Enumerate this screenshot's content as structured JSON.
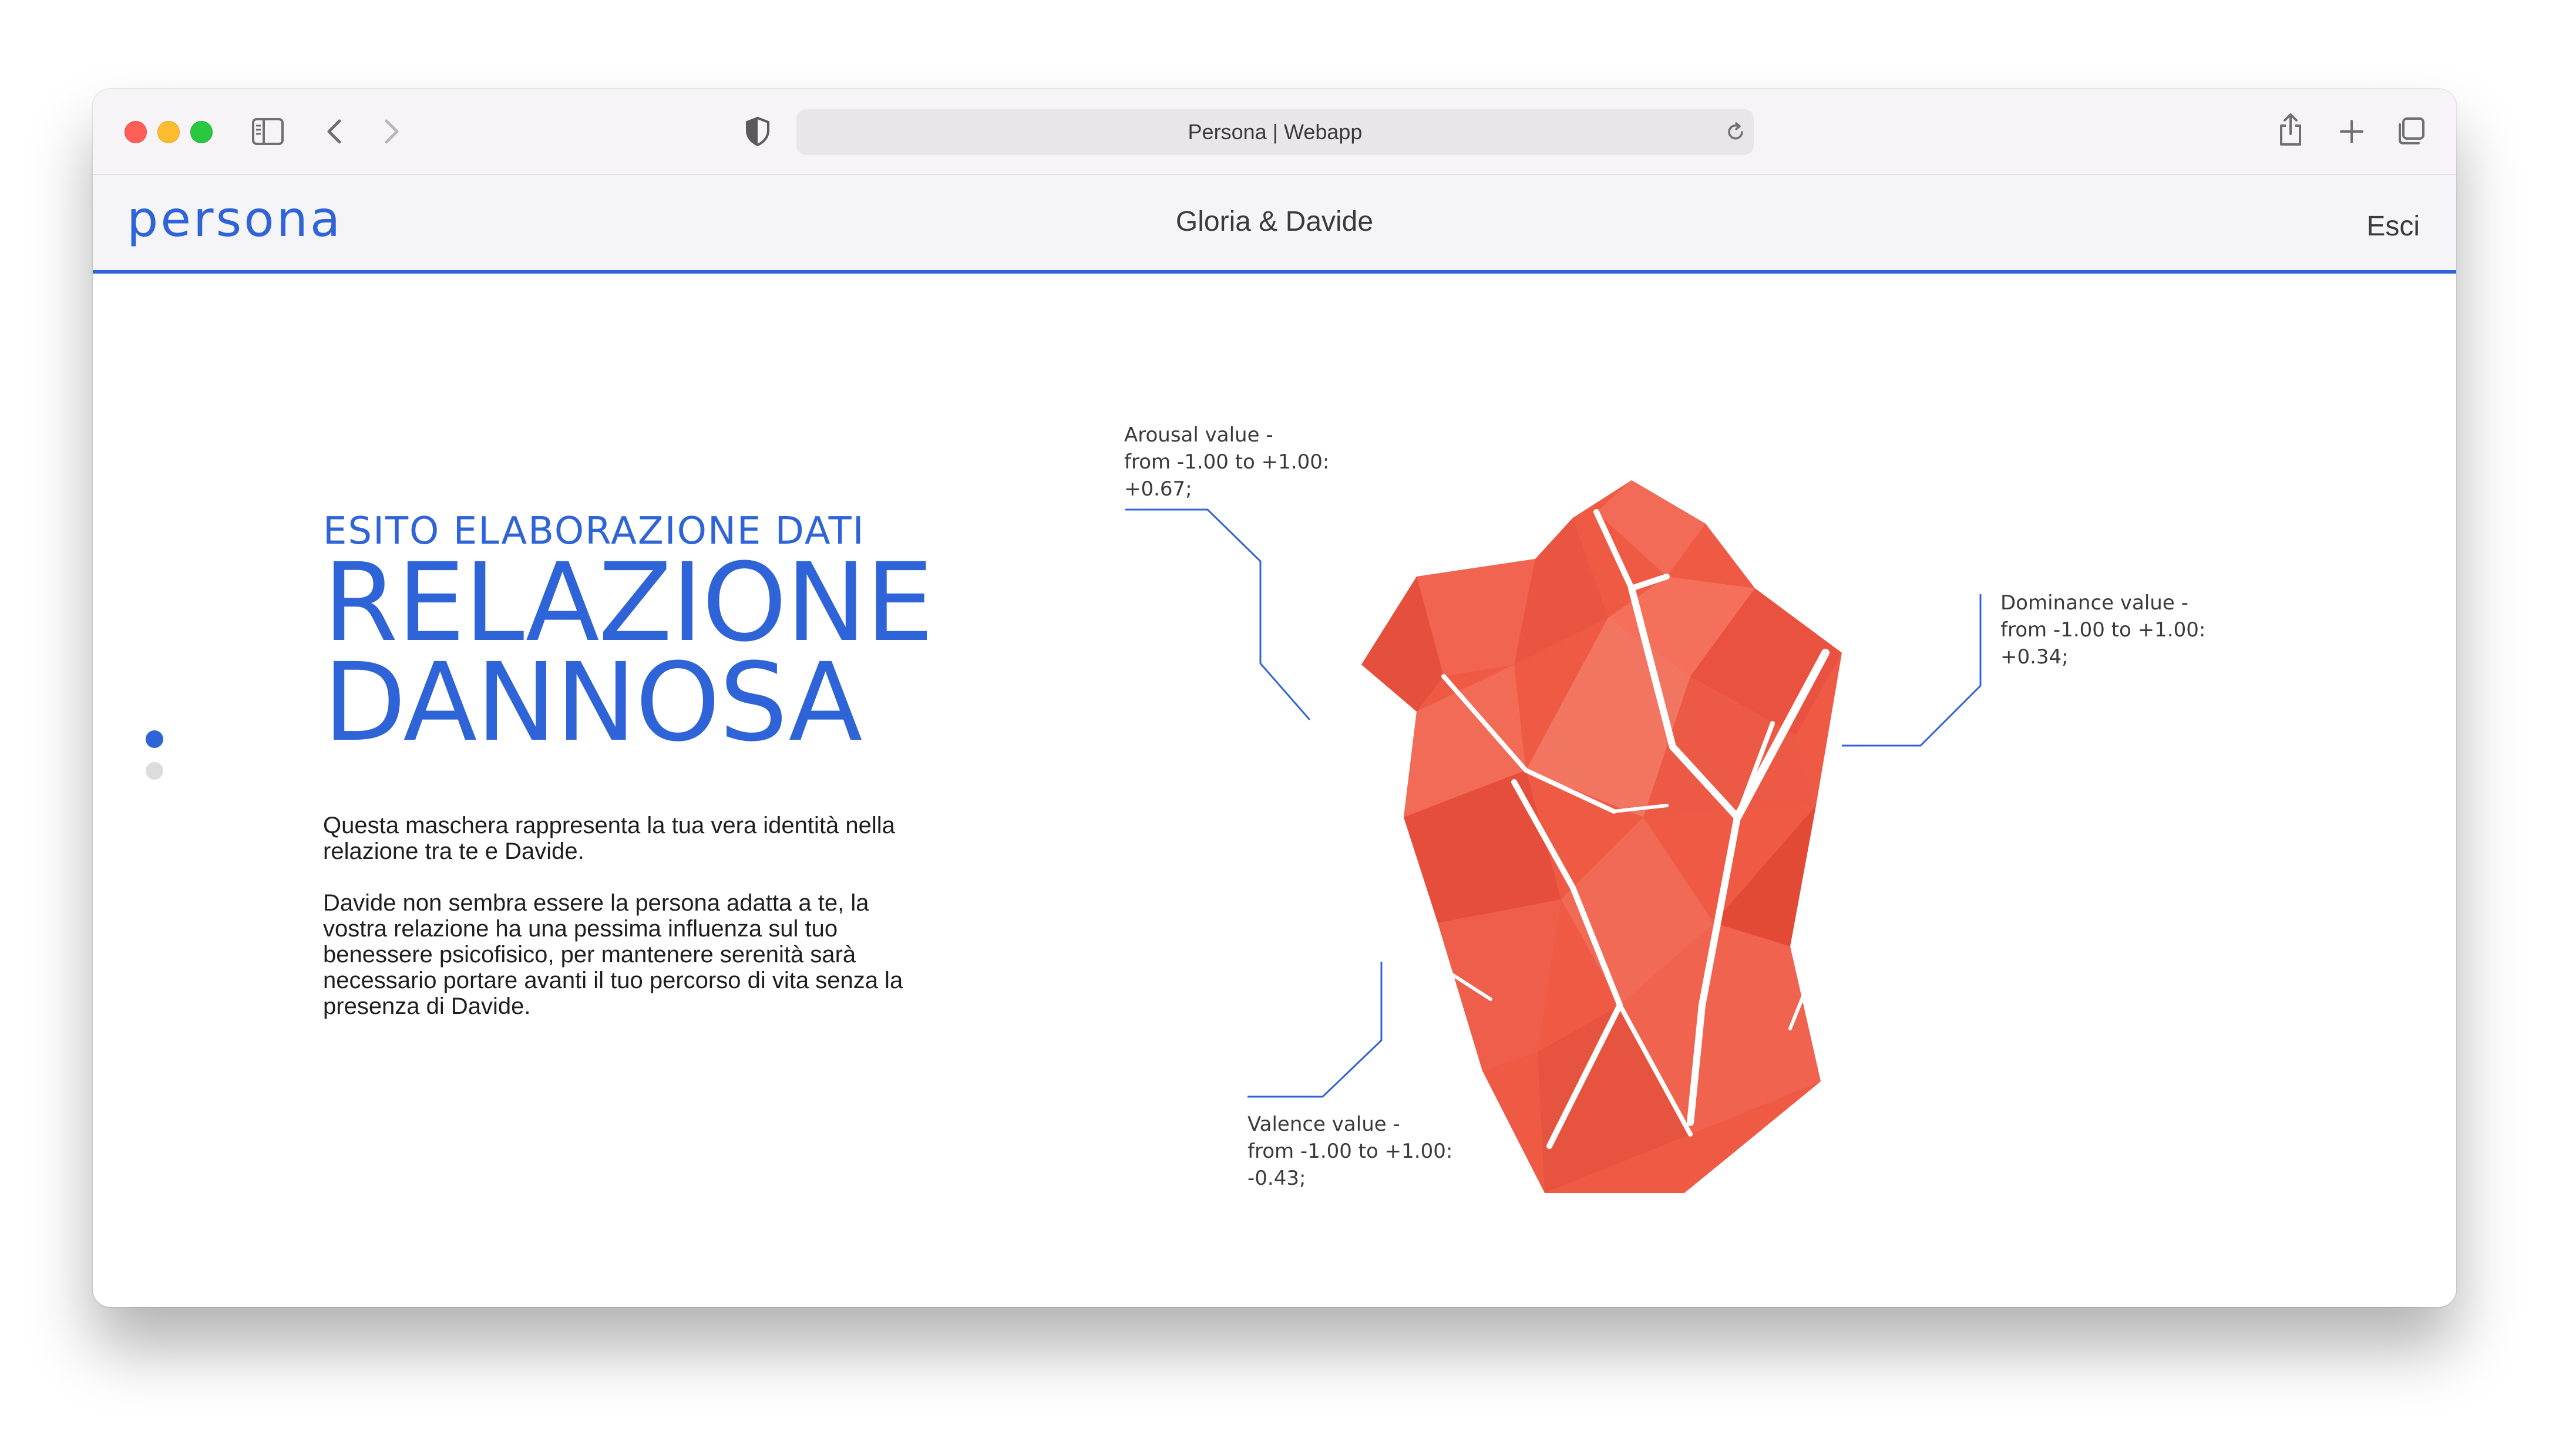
{
  "browser": {
    "url_text": "Persona | Webapp",
    "icons": [
      "sidebar-icon",
      "back-chevron-icon",
      "forward-chevron-icon",
      "shield-icon",
      "reload-icon",
      "share-icon",
      "plus-icon",
      "tabs-icon"
    ]
  },
  "header": {
    "logo": "persona",
    "title": "Gloria & Davide",
    "logout_label": "Esci"
  },
  "pagination": {
    "count": 2,
    "active_index": 0
  },
  "result": {
    "eyebrow": "ESITO ELABORAZIONE DATI",
    "headline_line1": "RELAZIONE",
    "headline_line2": "DANNOSA",
    "paragraph1": "Questa maschera rappresenta la tua vera identità nella relazione tra te e Davide.",
    "paragraph2": "Davide non sembra essere la persona adatta a te, la vostra relazione ha una pessima influenza sul tuo benessere psicofisico, per mantenere serenità sarà necessario portare avanti il tuo percorso di vita senza la presenza di Davide."
  },
  "dimensions": {
    "arousal": {
      "line1": "Arousal value -",
      "line2": "from -1.00 to +1.00:",
      "line3": "+0.67;"
    },
    "dominance": {
      "line1": "Dominance value -",
      "line2": "from -1.00 to +1.00:",
      "line3": "+0.34;"
    },
    "valence": {
      "line1": "Valence value -",
      "line2": "from -1.00 to +1.00:",
      "line3": "-0.43;"
    }
  },
  "colors": {
    "accent": "#2f64d8",
    "crystal": "#ef5a45",
    "text": "#1e1e1e"
  }
}
